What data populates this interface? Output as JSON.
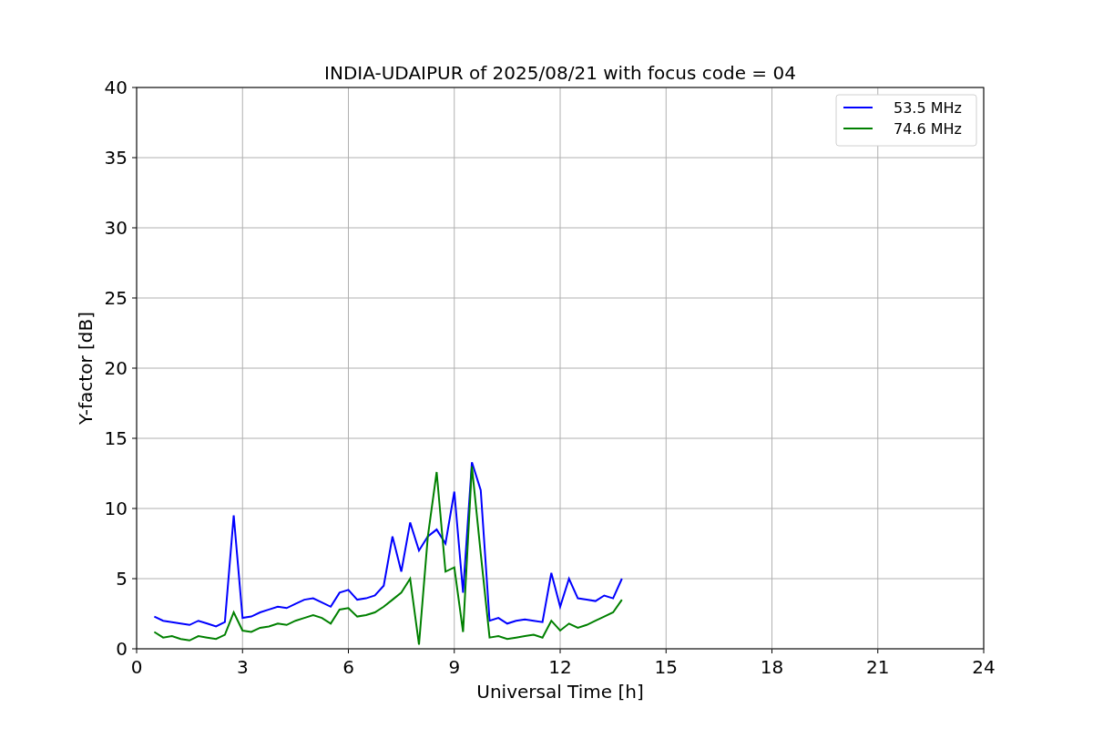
{
  "chart_data": {
    "type": "line",
    "title": "INDIA-UDAIPUR of 2025/08/21 with focus code = 04",
    "xlabel": "Universal Time [h]",
    "ylabel": "Y-factor [dB]",
    "x": [
      0.5,
      0.75,
      1,
      1.25,
      1.5,
      1.75,
      2,
      2.25,
      2.5,
      2.75,
      3,
      3.25,
      3.5,
      3.75,
      4,
      4.25,
      4.5,
      4.75,
      5,
      5.25,
      5.5,
      5.75,
      6,
      6.25,
      6.5,
      6.75,
      7,
      7.25,
      7.5,
      7.75,
      8,
      8.25,
      8.5,
      8.75,
      9,
      9.25,
      9.5,
      9.75,
      10,
      10.25,
      10.5,
      10.75,
      11,
      11.25,
      11.5,
      11.75,
      12,
      12.25,
      12.5,
      12.75,
      13,
      13.25,
      13.5,
      13.75
    ],
    "series": [
      {
        "name": "53.5 MHz",
        "color": "#0000ff",
        "values": [
          2.3,
          2.0,
          1.9,
          1.8,
          1.7,
          2.0,
          1.8,
          1.6,
          1.9,
          9.5,
          2.2,
          2.3,
          2.6,
          2.8,
          3.0,
          2.9,
          3.2,
          3.5,
          3.6,
          3.3,
          3.0,
          4.0,
          4.2,
          3.5,
          3.6,
          3.8,
          4.5,
          8.0,
          5.5,
          9.0,
          7.0,
          8.0,
          8.5,
          7.5,
          11.2,
          4.0,
          13.3,
          11.3,
          2.0,
          2.2,
          1.8,
          2.0,
          2.1,
          2.0,
          1.9,
          5.4,
          3.0,
          5.0,
          3.6,
          3.5,
          3.4,
          3.8,
          3.6,
          5.0
        ]
      },
      {
        "name": "74.6 MHz",
        "color": "#008000",
        "values": [
          1.2,
          0.8,
          0.9,
          0.7,
          0.6,
          0.9,
          0.8,
          0.7,
          1.0,
          2.6,
          1.3,
          1.2,
          1.5,
          1.6,
          1.8,
          1.7,
          2.0,
          2.2,
          2.4,
          2.2,
          1.8,
          2.8,
          2.9,
          2.3,
          2.4,
          2.6,
          3.0,
          3.5,
          4.0,
          5.0,
          0.3,
          8.0,
          12.6,
          5.5,
          5.8,
          1.2,
          13.0,
          6.8,
          0.8,
          0.9,
          0.7,
          0.8,
          0.9,
          1.0,
          0.8,
          2.0,
          1.3,
          1.8,
          1.5,
          1.7,
          2.0,
          2.3,
          2.6,
          3.5
        ]
      }
    ],
    "grid": true,
    "legend": true,
    "xlim": [
      0,
      24
    ],
    "ylim": [
      0,
      40
    ],
    "xticks": [
      0,
      3,
      6,
      9,
      12,
      15,
      18,
      21,
      24
    ],
    "yticks": [
      0,
      5,
      10,
      15,
      20,
      25,
      30,
      35,
      40
    ]
  }
}
